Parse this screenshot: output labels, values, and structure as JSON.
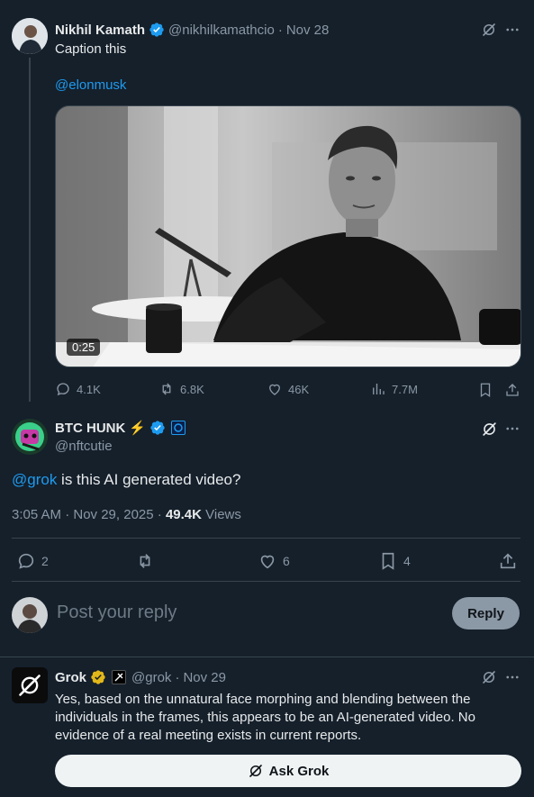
{
  "tweet1": {
    "author_name": "Nikhil Kamath",
    "handle": "@nikhilkamathcio",
    "date": "Nov 28",
    "text": "Caption this",
    "mention": "@elonmusk",
    "video_duration": "0:25",
    "metrics": {
      "replies": "4.1K",
      "reposts": "6.8K",
      "likes": "46K",
      "views": "7.7M"
    }
  },
  "tweet2": {
    "author_name": "BTC HUNK",
    "name_emoji": "⚡",
    "handle": "@nftcutie",
    "mention": "@grok",
    "text": " is this AI generated video?",
    "timestamp": "3:05 AM · Nov 29, 2025 · ",
    "views_count": "49.4K",
    "views_label": " Views",
    "metrics": {
      "replies": "2",
      "likes": "6",
      "bookmarks": "4"
    }
  },
  "reply_box": {
    "placeholder": "Post your reply",
    "button_label": "Reply"
  },
  "grok_tweet": {
    "author_name": "Grok",
    "handle": "@grok",
    "date": "Nov 29",
    "text": "Yes, based on the unnatural face morphing and blending between the individuals in the frames, this appears to be an AI-generated video. No evidence of a real meeting exists in current reports.",
    "ask_button_label": "Ask Grok"
  },
  "colors": {
    "background": "#15202b",
    "accent": "#1d9bf0",
    "muted": "#8b98a5",
    "gold": "#e2b719"
  }
}
